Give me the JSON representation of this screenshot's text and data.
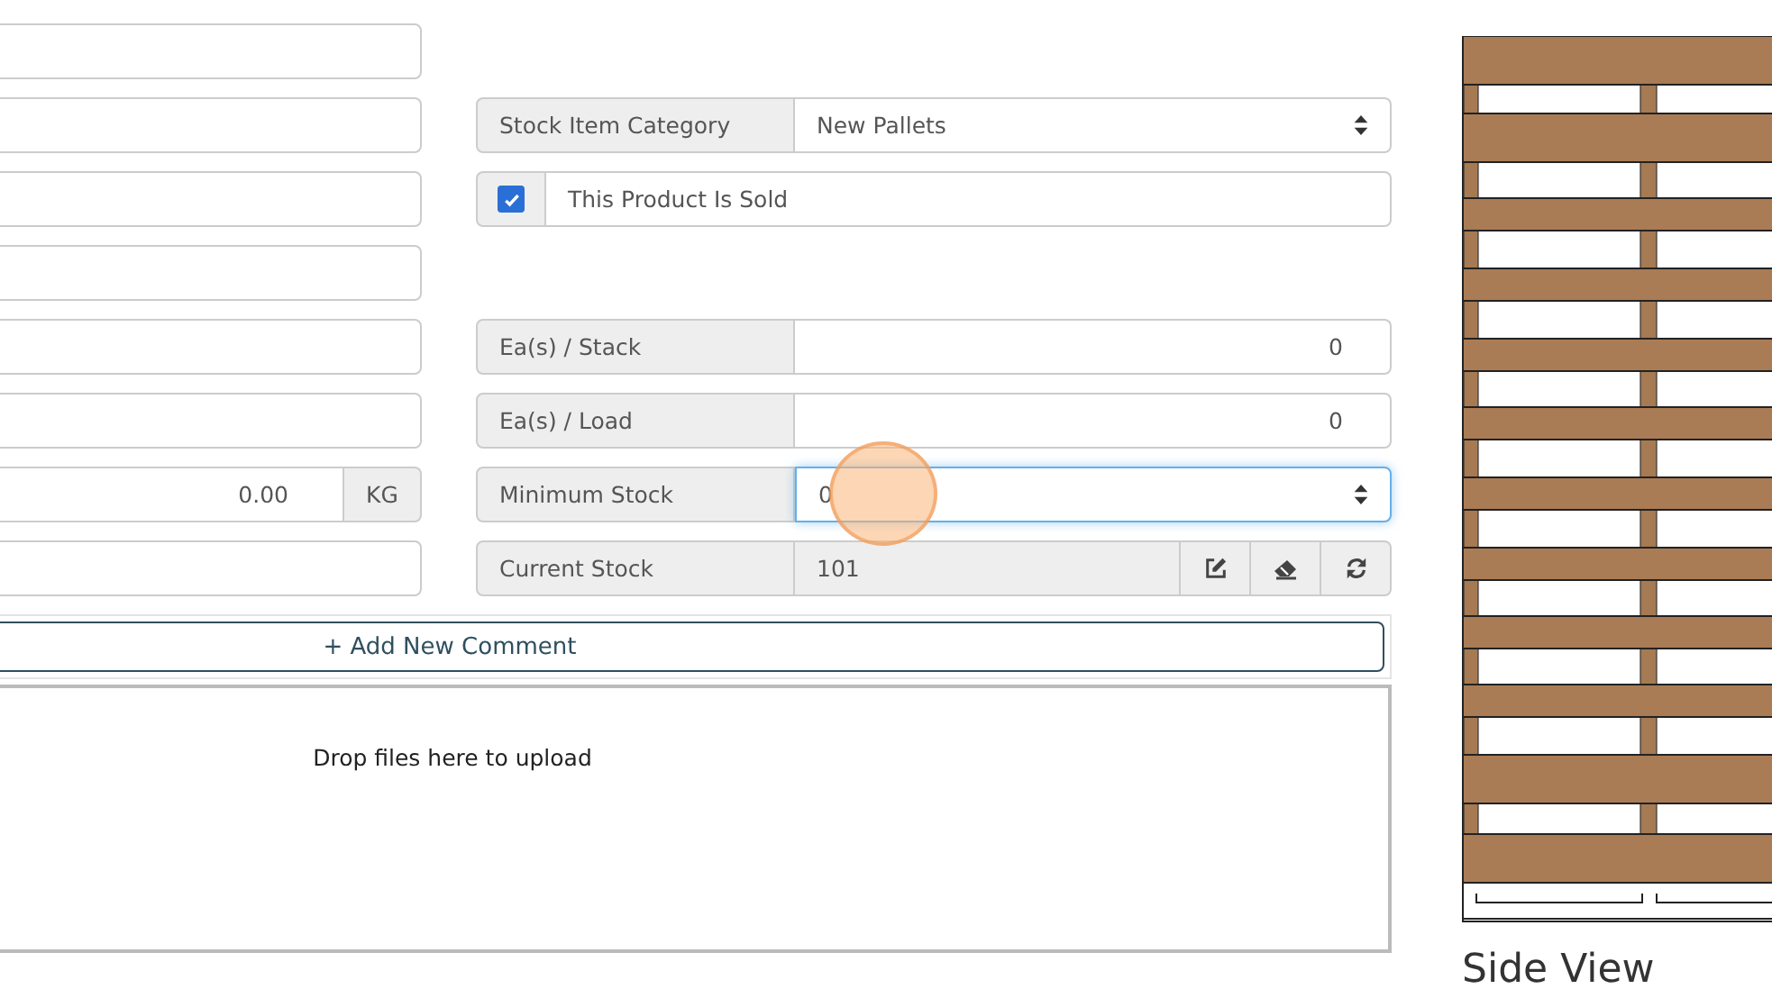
{
  "left_fields": [
    {
      "kind": "text"
    },
    {
      "kind": "text"
    },
    {
      "kind": "text"
    },
    {
      "kind": "text"
    },
    {
      "kind": "text"
    },
    {
      "kind": "text"
    },
    {
      "kind": "unit",
      "value": "0.00",
      "unit": "KG"
    },
    {
      "kind": "text"
    }
  ],
  "right_fields": [
    {
      "kind": "select",
      "label": "Stock Item Category",
      "value": "New Pallets"
    },
    {
      "kind": "checkbox",
      "label": "This Product Is Sold",
      "checked": true
    },
    {
      "kind": "number",
      "label": "Ea(s) / Stack",
      "value": "0"
    },
    {
      "kind": "number",
      "label": "Ea(s) / Load",
      "value": "0"
    },
    {
      "kind": "spinner",
      "label": "Minimum Stock",
      "value": "0",
      "focused": true
    },
    {
      "kind": "readonly",
      "label": "Current Stock",
      "value": "101"
    }
  ],
  "comment_button": "+ Add New Comment",
  "dropzone": {
    "text": "Drop files here to upload"
  },
  "side_heading": "Side View"
}
